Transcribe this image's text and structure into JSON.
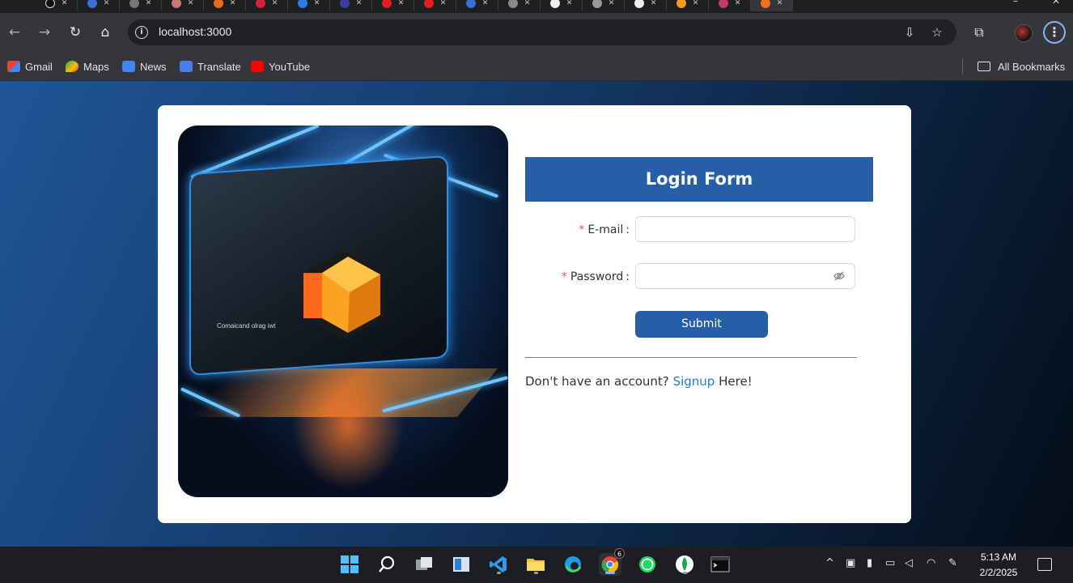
{
  "browser": {
    "url": "localhost:3000",
    "bookmarks": [
      {
        "label": "Gmail",
        "icon": "gmail-icon"
      },
      {
        "label": "Maps",
        "icon": "maps-icon"
      },
      {
        "label": "News",
        "icon": "news-icon"
      },
      {
        "label": "Translate",
        "icon": "translate-icon"
      },
      {
        "label": "YouTube",
        "icon": "youtube-icon"
      }
    ],
    "all_bookmarks_label": "All Bookmarks"
  },
  "hero": {
    "caption": "Comaicand olrag iwt"
  },
  "form": {
    "title": "Login Form",
    "email_label": "E-mail",
    "password_label": "Password",
    "required_mark": "*",
    "colon": ":",
    "email_value": "",
    "password_value": "",
    "submit_label": "Submit",
    "signup_prefix": "Don't have an account?",
    "signup_link": "Signup",
    "signup_suffix": "Here!"
  },
  "taskbar": {
    "time": "5:13 AM",
    "date": "2/2/2025",
    "chrome_badge": "6",
    "apps": [
      "windows-start-icon",
      "search-icon",
      "task-view-icon",
      "widgets-icon",
      "vscode-icon",
      "file-explorer-icon",
      "edge-icon",
      "chrome-icon",
      "whatsapp-icon",
      "mongodb-icon",
      "terminal-icon"
    ]
  },
  "colors": {
    "accent": "#265ea8",
    "link": "#1f7bd4",
    "required": "#ff4d4f"
  }
}
